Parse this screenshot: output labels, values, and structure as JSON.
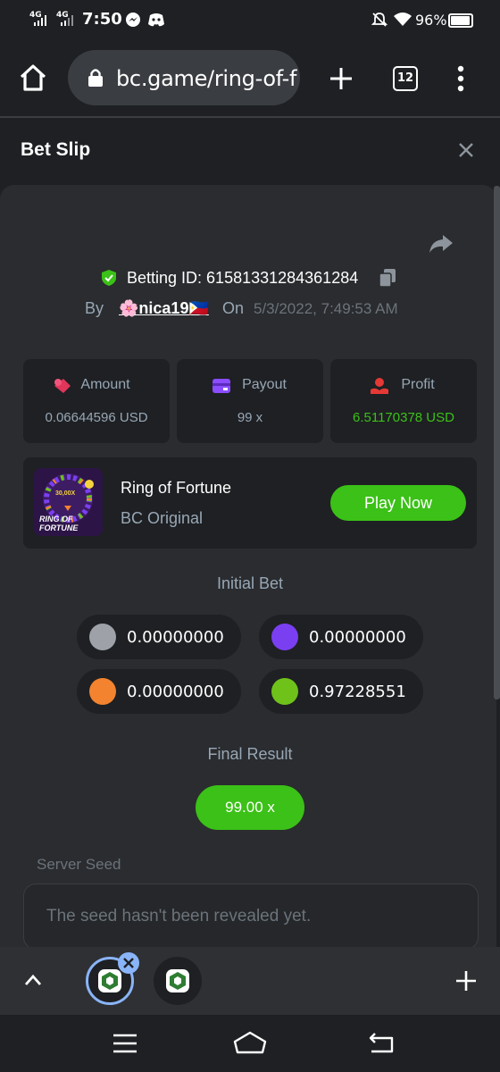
{
  "status_bar": {
    "net1": "4G",
    "net2": "4G",
    "time": "7:50",
    "battery": "96%"
  },
  "browser": {
    "url": "bc.game/ring-of-f",
    "tab_count": "12"
  },
  "slip": {
    "title": "Bet Slip",
    "betting_id": "Betting ID: 61581331284361284",
    "by_label": "By",
    "username": "🌸nica19🇵🇭",
    "on_label": "On",
    "datetime": "5/3/2022, 7:49:53 AM",
    "stats": [
      {
        "label": "Amount",
        "value": "0.06644596 USD"
      },
      {
        "label": "Payout",
        "value": "99 x"
      },
      {
        "label": "Profit",
        "value": "6.51170378 USD"
      }
    ],
    "game": {
      "name": "Ring of Fortune",
      "provider": "BC Original",
      "thumb_text_top": "30,00X",
      "thumb_text_bottom1": "RING OF",
      "thumb_text_bottom2": "FORTUNE",
      "play_label": "Play Now"
    },
    "initial_bet_title": "Initial Bet",
    "bets": [
      {
        "color": "#9ea2a8",
        "amount": "0.00000000"
      },
      {
        "color": "#7b3ff2",
        "amount": "0.00000000"
      },
      {
        "color": "#f3832e",
        "amount": "0.00000000"
      },
      {
        "color": "#6fc21a",
        "amount": "0.97228551"
      }
    ],
    "final_result_title": "Final Result",
    "final_result": "99.00 x",
    "server_seed_label": "Server Seed",
    "server_seed_placeholder": "The seed hasn't been revealed yet."
  },
  "colors": {
    "accent_green": "#3bc117",
    "profit_green": "#3bc117",
    "card_bg": "#2a2c2f",
    "page_bg": "#1e2023"
  }
}
